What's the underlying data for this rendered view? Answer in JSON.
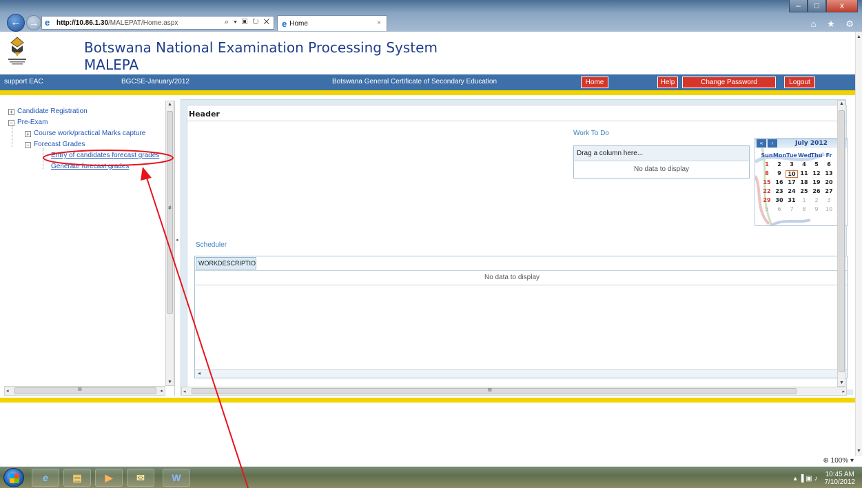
{
  "browser": {
    "url_host": "http://10.86.1.30",
    "url_path": "/MALEPAT/Home.aspx",
    "address_tools": "⌕ ▾ ▣ ↻ ✕",
    "tab_title": "Home",
    "tab_close": "×",
    "right_icons": "⌂ ★ ⚙",
    "window_buttons": {
      "minimize": "–",
      "maximize": "□",
      "close": "x"
    },
    "back": "←",
    "forward": "→",
    "zoom": "⊕ 100%  ▾"
  },
  "header": {
    "title": "Botswana National Examination Processing System",
    "subtitle": "MALEPA"
  },
  "navbar": {
    "user": "support EAC",
    "session": "BGCSE-January/2012",
    "program": "Botswana General Certificate of Secondary Education",
    "buttons": {
      "home": "Home",
      "help": "Help",
      "change_password": "Change Password",
      "logout": "Logout"
    }
  },
  "tree": {
    "candidate_registration": "Candidate Registration",
    "pre_exam": "Pre-Exam",
    "course_work": "Course work/practical Marks capture",
    "forecast_grades": "Forecast Grades",
    "entry_forecast": "Entry of candidates forecast grades",
    "generate_forecast": "Generate forecast grades",
    "expander_plus": "+",
    "expander_minus": "−"
  },
  "content": {
    "header_label": "Header",
    "work_to_do": {
      "label": "Work To Do",
      "group_hint": "Drag a column here...",
      "empty": "No data to display"
    },
    "calendar": {
      "month": "July 2012",
      "prev_year": "«",
      "prev_month": "‹",
      "day_names": [
        "Sun",
        "Mon",
        "Tue",
        "Wed",
        "Thu",
        "Fr"
      ],
      "weeks": [
        [
          "1",
          "2",
          "3",
          "4",
          "5",
          "6"
        ],
        [
          "8",
          "9",
          "10",
          "11",
          "12",
          "13"
        ],
        [
          "15",
          "16",
          "17",
          "18",
          "19",
          "20"
        ],
        [
          "22",
          "23",
          "24",
          "25",
          "26",
          "27"
        ],
        [
          "29",
          "30",
          "31",
          "1",
          "2",
          "3"
        ],
        [
          "5",
          "6",
          "7",
          "8",
          "9",
          "10"
        ]
      ],
      "today": "10"
    },
    "scheduler": {
      "label": "Scheduler",
      "column": "WORKDESCRIPTION",
      "empty": "No data to display",
      "hscroll_left": "◂"
    }
  },
  "scroll": {
    "grip": "≢",
    "grip_h": "III"
  },
  "taskbar": {
    "time": "10:45 AM",
    "date": "7/10/2012",
    "tray_icons": "▴ ▐ ▣ ♪",
    "apps": [
      "e",
      "▤",
      "▶",
      "✉",
      "W"
    ]
  },
  "colors": {
    "navbar": "#3d6fa8",
    "accent_red": "#d6362a",
    "accent_yellow": "#f0d400",
    "title_blue": "#1e3f8c",
    "link_blue": "#1f57b8",
    "annotation_red": "#e8141c"
  }
}
